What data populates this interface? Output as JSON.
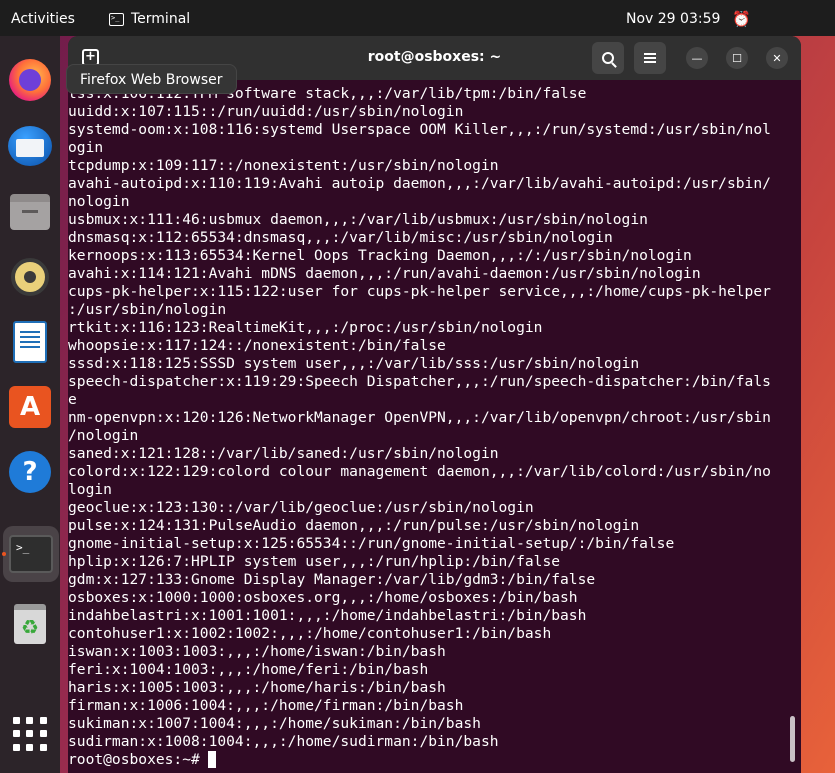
{
  "topbar": {
    "activities": "Activities",
    "app_name": "Terminal",
    "clock": "Nov 29  03:59"
  },
  "dock": {
    "items": [
      {
        "name": "Firefox Web Browser",
        "icon": "firefox-icon"
      },
      {
        "name": "Thunderbird Mail",
        "icon": "thunderbird-icon"
      },
      {
        "name": "Files",
        "icon": "files-icon"
      },
      {
        "name": "Rhythmbox",
        "icon": "rhythmbox-icon"
      },
      {
        "name": "LibreOffice Writer",
        "icon": "writer-icon"
      },
      {
        "name": "Ubuntu Software",
        "icon": "software-store-icon"
      },
      {
        "name": "Help",
        "icon": "help-icon"
      },
      {
        "name": "Terminal",
        "icon": "terminal-icon"
      },
      {
        "name": "Trash",
        "icon": "trash-icon"
      },
      {
        "name": "Show Applications",
        "icon": "app-grid-icon"
      }
    ],
    "tooltip": "Firefox Web Browser"
  },
  "window": {
    "title": "root@osboxes: ~"
  },
  "terminal": {
    "lines": [
      "tss:x:106:112:TPM software stack,,,:/var/lib/tpm:/bin/false",
      "uuidd:x:107:115::/run/uuidd:/usr/sbin/nologin",
      "systemd-oom:x:108:116:systemd Userspace OOM Killer,,,:/run/systemd:/usr/sbin/nol",
      "ogin",
      "tcpdump:x:109:117::/nonexistent:/usr/sbin/nologin",
      "avahi-autoipd:x:110:119:Avahi autoip daemon,,,:/var/lib/avahi-autoipd:/usr/sbin/",
      "nologin",
      "usbmux:x:111:46:usbmux daemon,,,:/var/lib/usbmux:/usr/sbin/nologin",
      "dnsmasq:x:112:65534:dnsmasq,,,:/var/lib/misc:/usr/sbin/nologin",
      "kernoops:x:113:65534:Kernel Oops Tracking Daemon,,,:/:/usr/sbin/nologin",
      "avahi:x:114:121:Avahi mDNS daemon,,,:/run/avahi-daemon:/usr/sbin/nologin",
      "cups-pk-helper:x:115:122:user for cups-pk-helper service,,,:/home/cups-pk-helper",
      ":/usr/sbin/nologin",
      "rtkit:x:116:123:RealtimeKit,,,:/proc:/usr/sbin/nologin",
      "whoopsie:x:117:124::/nonexistent:/bin/false",
      "sssd:x:118:125:SSSD system user,,,:/var/lib/sss:/usr/sbin/nologin",
      "speech-dispatcher:x:119:29:Speech Dispatcher,,,:/run/speech-dispatcher:/bin/fals",
      "e",
      "nm-openvpn:x:120:126:NetworkManager OpenVPN,,,:/var/lib/openvpn/chroot:/usr/sbin",
      "/nologin",
      "saned:x:121:128::/var/lib/saned:/usr/sbin/nologin",
      "colord:x:122:129:colord colour management daemon,,,:/var/lib/colord:/usr/sbin/no",
      "login",
      "geoclue:x:123:130::/var/lib/geoclue:/usr/sbin/nologin",
      "pulse:x:124:131:PulseAudio daemon,,,:/run/pulse:/usr/sbin/nologin",
      "gnome-initial-setup:x:125:65534::/run/gnome-initial-setup/:/bin/false",
      "hplip:x:126:7:HPLIP system user,,,:/run/hplip:/bin/false",
      "gdm:x:127:133:Gnome Display Manager:/var/lib/gdm3:/bin/false",
      "osboxes:x:1000:1000:osboxes.org,,,:/home/osboxes:/bin/bash",
      "indahbelastri:x:1001:1001:,,,:/home/indahbelastri:/bin/bash",
      "contohuser1:x:1002:1002:,,,:/home/contohuser1:/bin/bash",
      "iswan:x:1003:1003:,,,:/home/iswan:/bin/bash",
      "feri:x:1004:1003:,,,:/home/feri:/bin/bash",
      "haris:x:1005:1003:,,,:/home/haris:/bin/bash",
      "firman:x:1006:1004:,,,:/home/firman:/bin/bash",
      "sukiman:x:1007:1004:,,,:/home/sukiman:/bin/bash",
      "sudirman:x:1008:1004:,,,:/home/sudirman:/bin/bash"
    ],
    "prompt": "root@osboxes:~#"
  },
  "colors": {
    "terminal_bg": "#300a24",
    "accent": "#e95420",
    "topbar_bg": "#1d1d1d"
  }
}
